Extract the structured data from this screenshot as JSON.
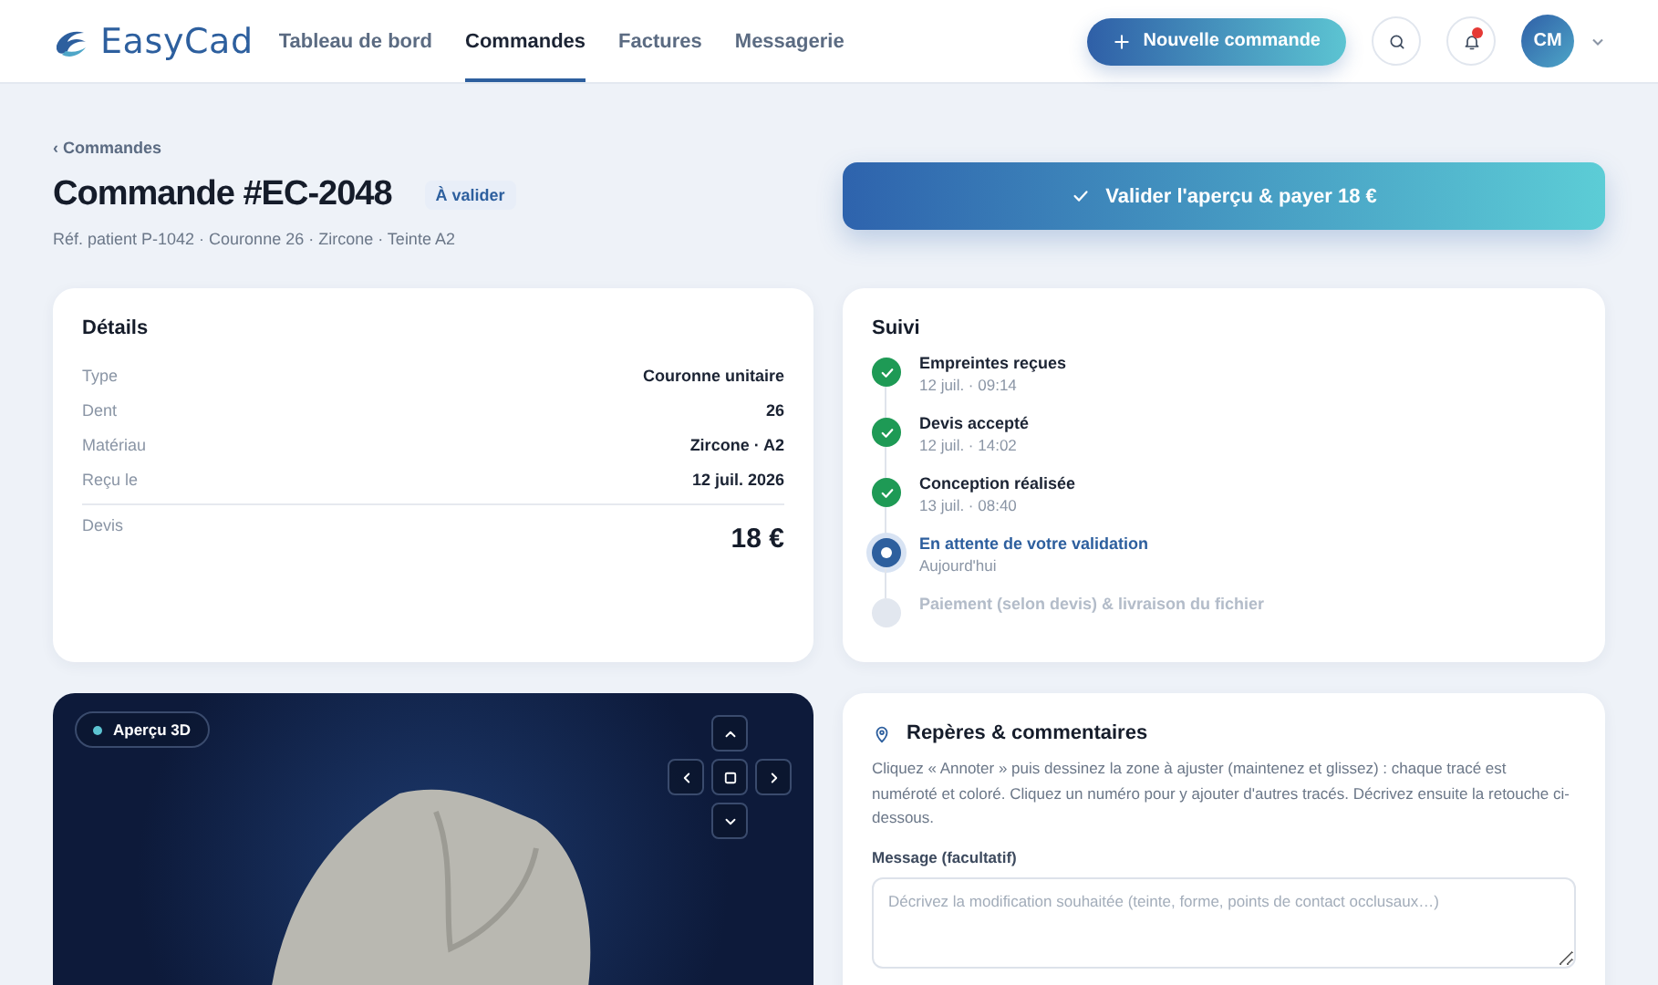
{
  "header": {
    "logo": "EasyCad",
    "nav": [
      {
        "label": "Tableau de bord",
        "selected": false
      },
      {
        "label": "Commandes",
        "selected": true
      },
      {
        "label": "Factures",
        "selected": false
      },
      {
        "label": "Messagerie",
        "selected": false
      }
    ],
    "new_order_button": "Nouvelle commande",
    "notifications_unread": true,
    "avatar": "CM"
  },
  "breadcrumb": "‹ Commandes",
  "title": "Commande #EC-2048",
  "status_badge": "À valider",
  "subtitle": "Réf. patient P-1042 · Couronne 26 · Zircone · Teinte A2",
  "validate_button": "Valider l'aperçu & payer 18 €",
  "details": {
    "title": "Détails",
    "rows": [
      {
        "label": "Type",
        "value": "Couronne unitaire"
      },
      {
        "label": "Dent",
        "value": "26"
      },
      {
        "label": "Matériau",
        "value": "Zircone · A2"
      },
      {
        "label": "Reçu le",
        "value": "12 juil. 2026"
      }
    ],
    "total_label": "Devis",
    "total_value": "18 €"
  },
  "tracking": {
    "title": "Suivi",
    "steps": [
      {
        "title": "Empreintes reçues",
        "time": "12 juil. · 09:14",
        "done": true,
        "current": false
      },
      {
        "title": "Devis accepté",
        "time": "12 juil. · 14:02",
        "done": true,
        "current": false
      },
      {
        "title": "Conception réalisée",
        "time": "13 juil. · 08:40",
        "done": true,
        "current": false
      },
      {
        "title": "En attente de votre validation",
        "time": "Aujourd'hui",
        "done": false,
        "current": true
      },
      {
        "title": "Paiement (selon devis) & livraison du fichier",
        "done": false,
        "current": false
      }
    ]
  },
  "viewer": {
    "label": "Aperçu 3D"
  },
  "annotations": {
    "title": "Repères & commentaires",
    "help": "Cliquez « Annoter » puis dessinez la zone à ajuster (maintenez et glissez) : chaque tracé est numéroté et coloré. Cliquez un numéro pour y ajouter d'autres tracés. Décrivez ensuite la retouche ci-dessous.",
    "message_label": "Message (facultatif)",
    "message_placeholder": "Décrivez la modification souhaitée (teinte, forme, points de contact occlusaux…)"
  }
}
